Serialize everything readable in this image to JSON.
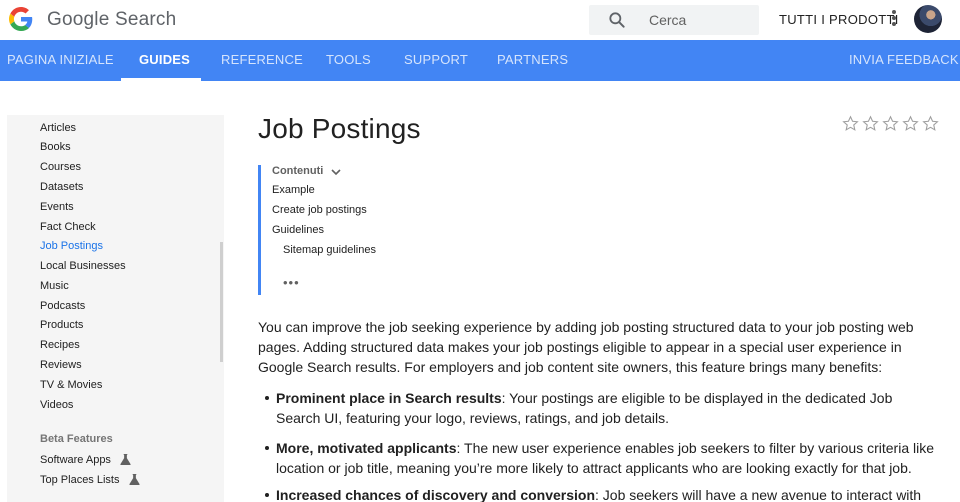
{
  "header": {
    "brand": "Google Search",
    "search_placeholder": "Cerca",
    "all_products": "TUTTI I PRODOTTI",
    "colors": {
      "nav": "#4285f4",
      "link_active": "#1a73e8"
    }
  },
  "nav": {
    "items": [
      {
        "label": "PAGINA INIZIALE"
      },
      {
        "label": "GUIDES"
      },
      {
        "label": "REFERENCE"
      },
      {
        "label": "TOOLS"
      },
      {
        "label": "SUPPORT"
      },
      {
        "label": "PARTNERS"
      }
    ],
    "active": "GUIDES",
    "feedback": "INVIA FEEDBACK"
  },
  "sidebar": {
    "items": [
      {
        "label": "Articles"
      },
      {
        "label": "Books"
      },
      {
        "label": "Courses"
      },
      {
        "label": "Datasets"
      },
      {
        "label": "Events"
      },
      {
        "label": "Fact Check"
      },
      {
        "label": "Job Postings"
      },
      {
        "label": "Local Businesses"
      },
      {
        "label": "Music"
      },
      {
        "label": "Podcasts"
      },
      {
        "label": "Products"
      },
      {
        "label": "Recipes"
      },
      {
        "label": "Reviews"
      },
      {
        "label": "TV & Movies"
      },
      {
        "label": "Videos"
      }
    ],
    "current": "Job Postings",
    "beta_heading": "Beta Features",
    "beta_items": [
      {
        "label": "Software Apps",
        "icon": "beaker-icon"
      },
      {
        "label": "Top Places Lists",
        "icon": "beaker-icon"
      }
    ]
  },
  "main": {
    "title": "Job Postings",
    "rating_stars": 5,
    "toc": {
      "heading": "Contenuti",
      "items": [
        {
          "label": "Example"
        },
        {
          "label": "Create job postings"
        },
        {
          "label": "Guidelines"
        },
        {
          "label": "Sitemap guidelines"
        }
      ],
      "more": "•••"
    },
    "intro": "You can improve the job seeking experience by adding job posting structured data to your job posting web pages. Adding structured data makes your job postings eligible to appear in a special user experience in Google Search results. For employers and job content site owners, this feature brings many benefits:",
    "benefits": [
      {
        "title": "Prominent place in Search results",
        "text": ": Your postings are eligible to be displayed in the dedicated Job Search UI, featuring your logo, reviews, ratings, and job details."
      },
      {
        "title": "More, motivated applicants",
        "text": ": The new user experience enables job seekers to filter by various criteria like location or job title, meaning you’re more likely to attract applicants who are looking exactly for that job."
      },
      {
        "title": "Increased chances of discovery and conversion",
        "text": ": Job seekers will have a new avenue to interact with your"
      }
    ]
  }
}
